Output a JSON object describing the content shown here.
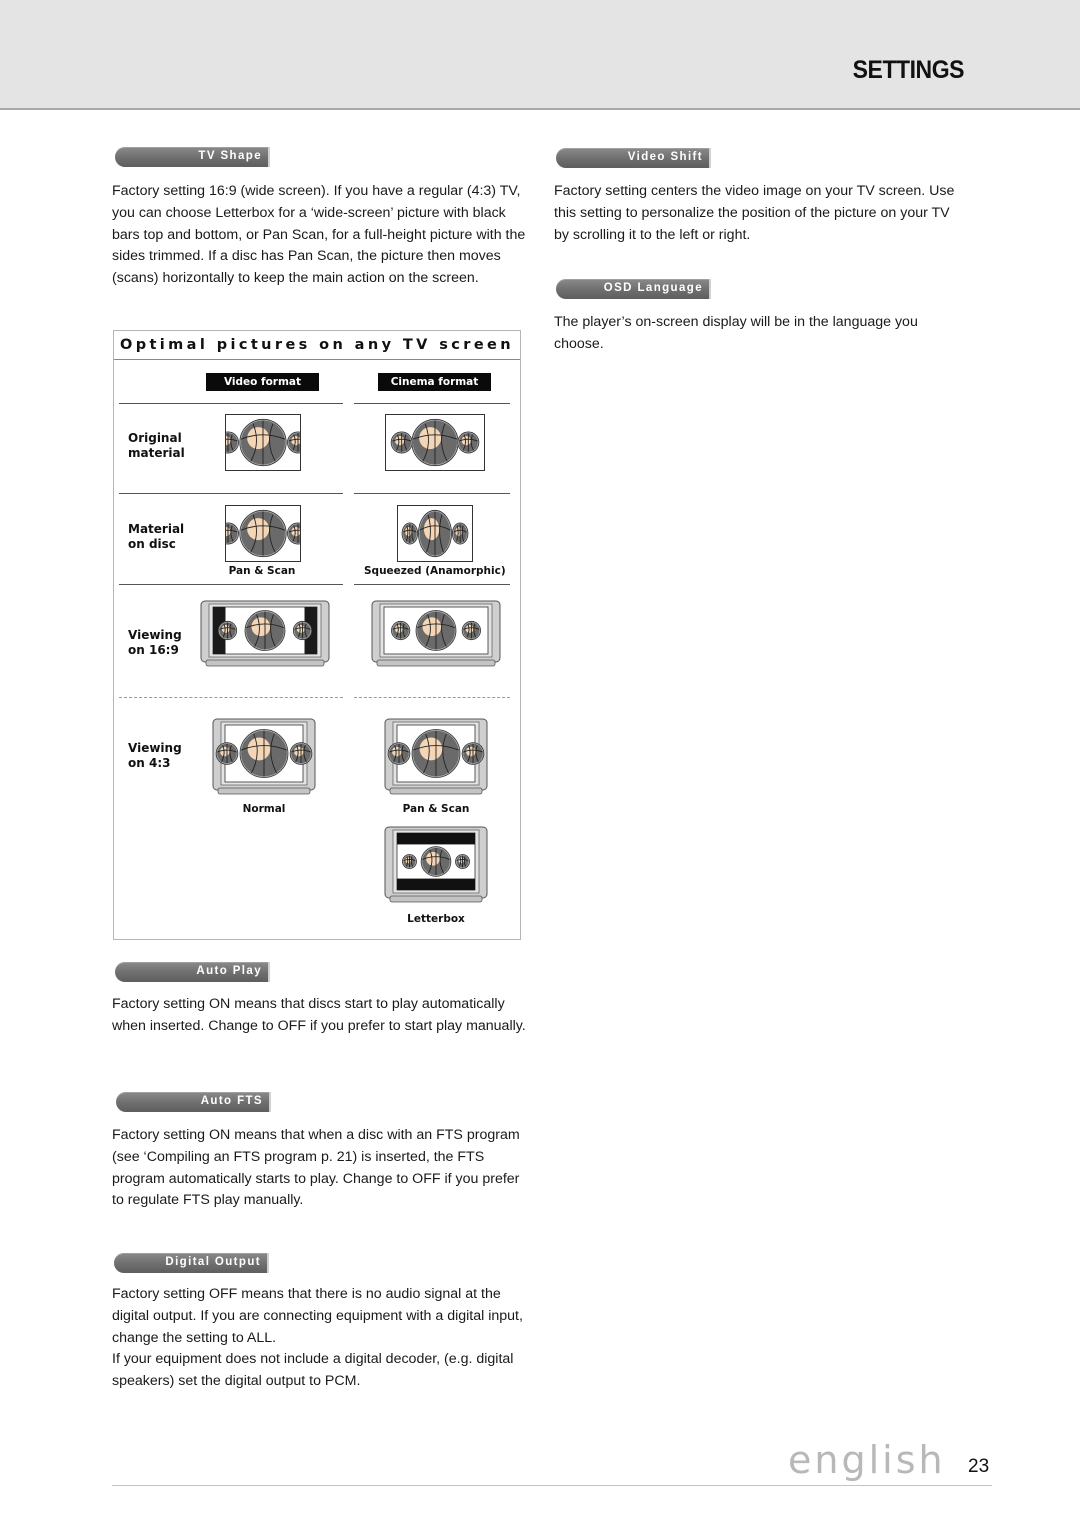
{
  "header": {
    "title": "SETTINGS"
  },
  "left_column": {
    "tv_shape": {
      "label": "TV Shape",
      "text": "Factory setting 16:9 (wide screen). If you have a regular (4:3) TV, you can choose Letterbox for a ‘wide-screen’ picture with black bars top and bottom, or Pan Scan, for a full-height picture with the sides trimmed. If a disc has Pan Scan, the picture then moves (scans) horizontally to keep the main action on the screen."
    },
    "diagram": {
      "title": "Optimal pictures on any TV screen",
      "columns": [
        "Video format",
        "Cinema format"
      ],
      "rows": [
        {
          "label_line1": "Original",
          "label_line2": "material",
          "captions": [
            "",
            ""
          ]
        },
        {
          "label_line1": "Material",
          "label_line2": "on disc",
          "captions": [
            "Pan & Scan",
            "Squeezed (Anamorphic)"
          ]
        },
        {
          "label_line1": "Viewing",
          "label_line2": "on 16:9",
          "captions": [
            "",
            ""
          ]
        },
        {
          "label_line1": "Viewing",
          "label_line2": "on 4:3",
          "captions": [
            "Normal",
            "Pan & Scan"
          ]
        }
      ],
      "extra_caption": "Letterbox"
    },
    "auto_play": {
      "label": "Auto Play",
      "text": "Factory setting ON means that discs start to play automatically when inserted. Change to OFF if you prefer to start play manually."
    },
    "auto_fts": {
      "label": "Auto FTS",
      "text": "Factory setting ON means that when a disc with an FTS program (see ‘Compiling an FTS program p. 21) is inserted, the FTS program automatically starts to play. Change to OFF if you prefer to regulate FTS play manually."
    },
    "digital_output": {
      "label": "Digital Output",
      "text1": "Factory setting OFF means that there is no audio signal at the digital output. If you are connecting equipment with a digital input, change the setting to ALL.",
      "text2": "If your equipment does not include a digital decoder, (e.g. digital speakers) set the digital output to PCM."
    }
  },
  "right_column": {
    "video_shift": {
      "label": "Video Shift",
      "text": "Factory setting centers the video image on your TV screen. Use this setting to personalize the position of the picture on your TV by scrolling it to the left or right."
    },
    "osd_language": {
      "label": "OSD Language",
      "text": "The player’s on-screen display will be in the language you choose."
    }
  },
  "footer": {
    "language": "english",
    "page_number": "23"
  },
  "colors": {
    "pill": "#6e6e6e",
    "ball_dark": "#6a6a6a",
    "ball_light": "#f4d6b6",
    "footer_lang": "#b8b8b8"
  }
}
